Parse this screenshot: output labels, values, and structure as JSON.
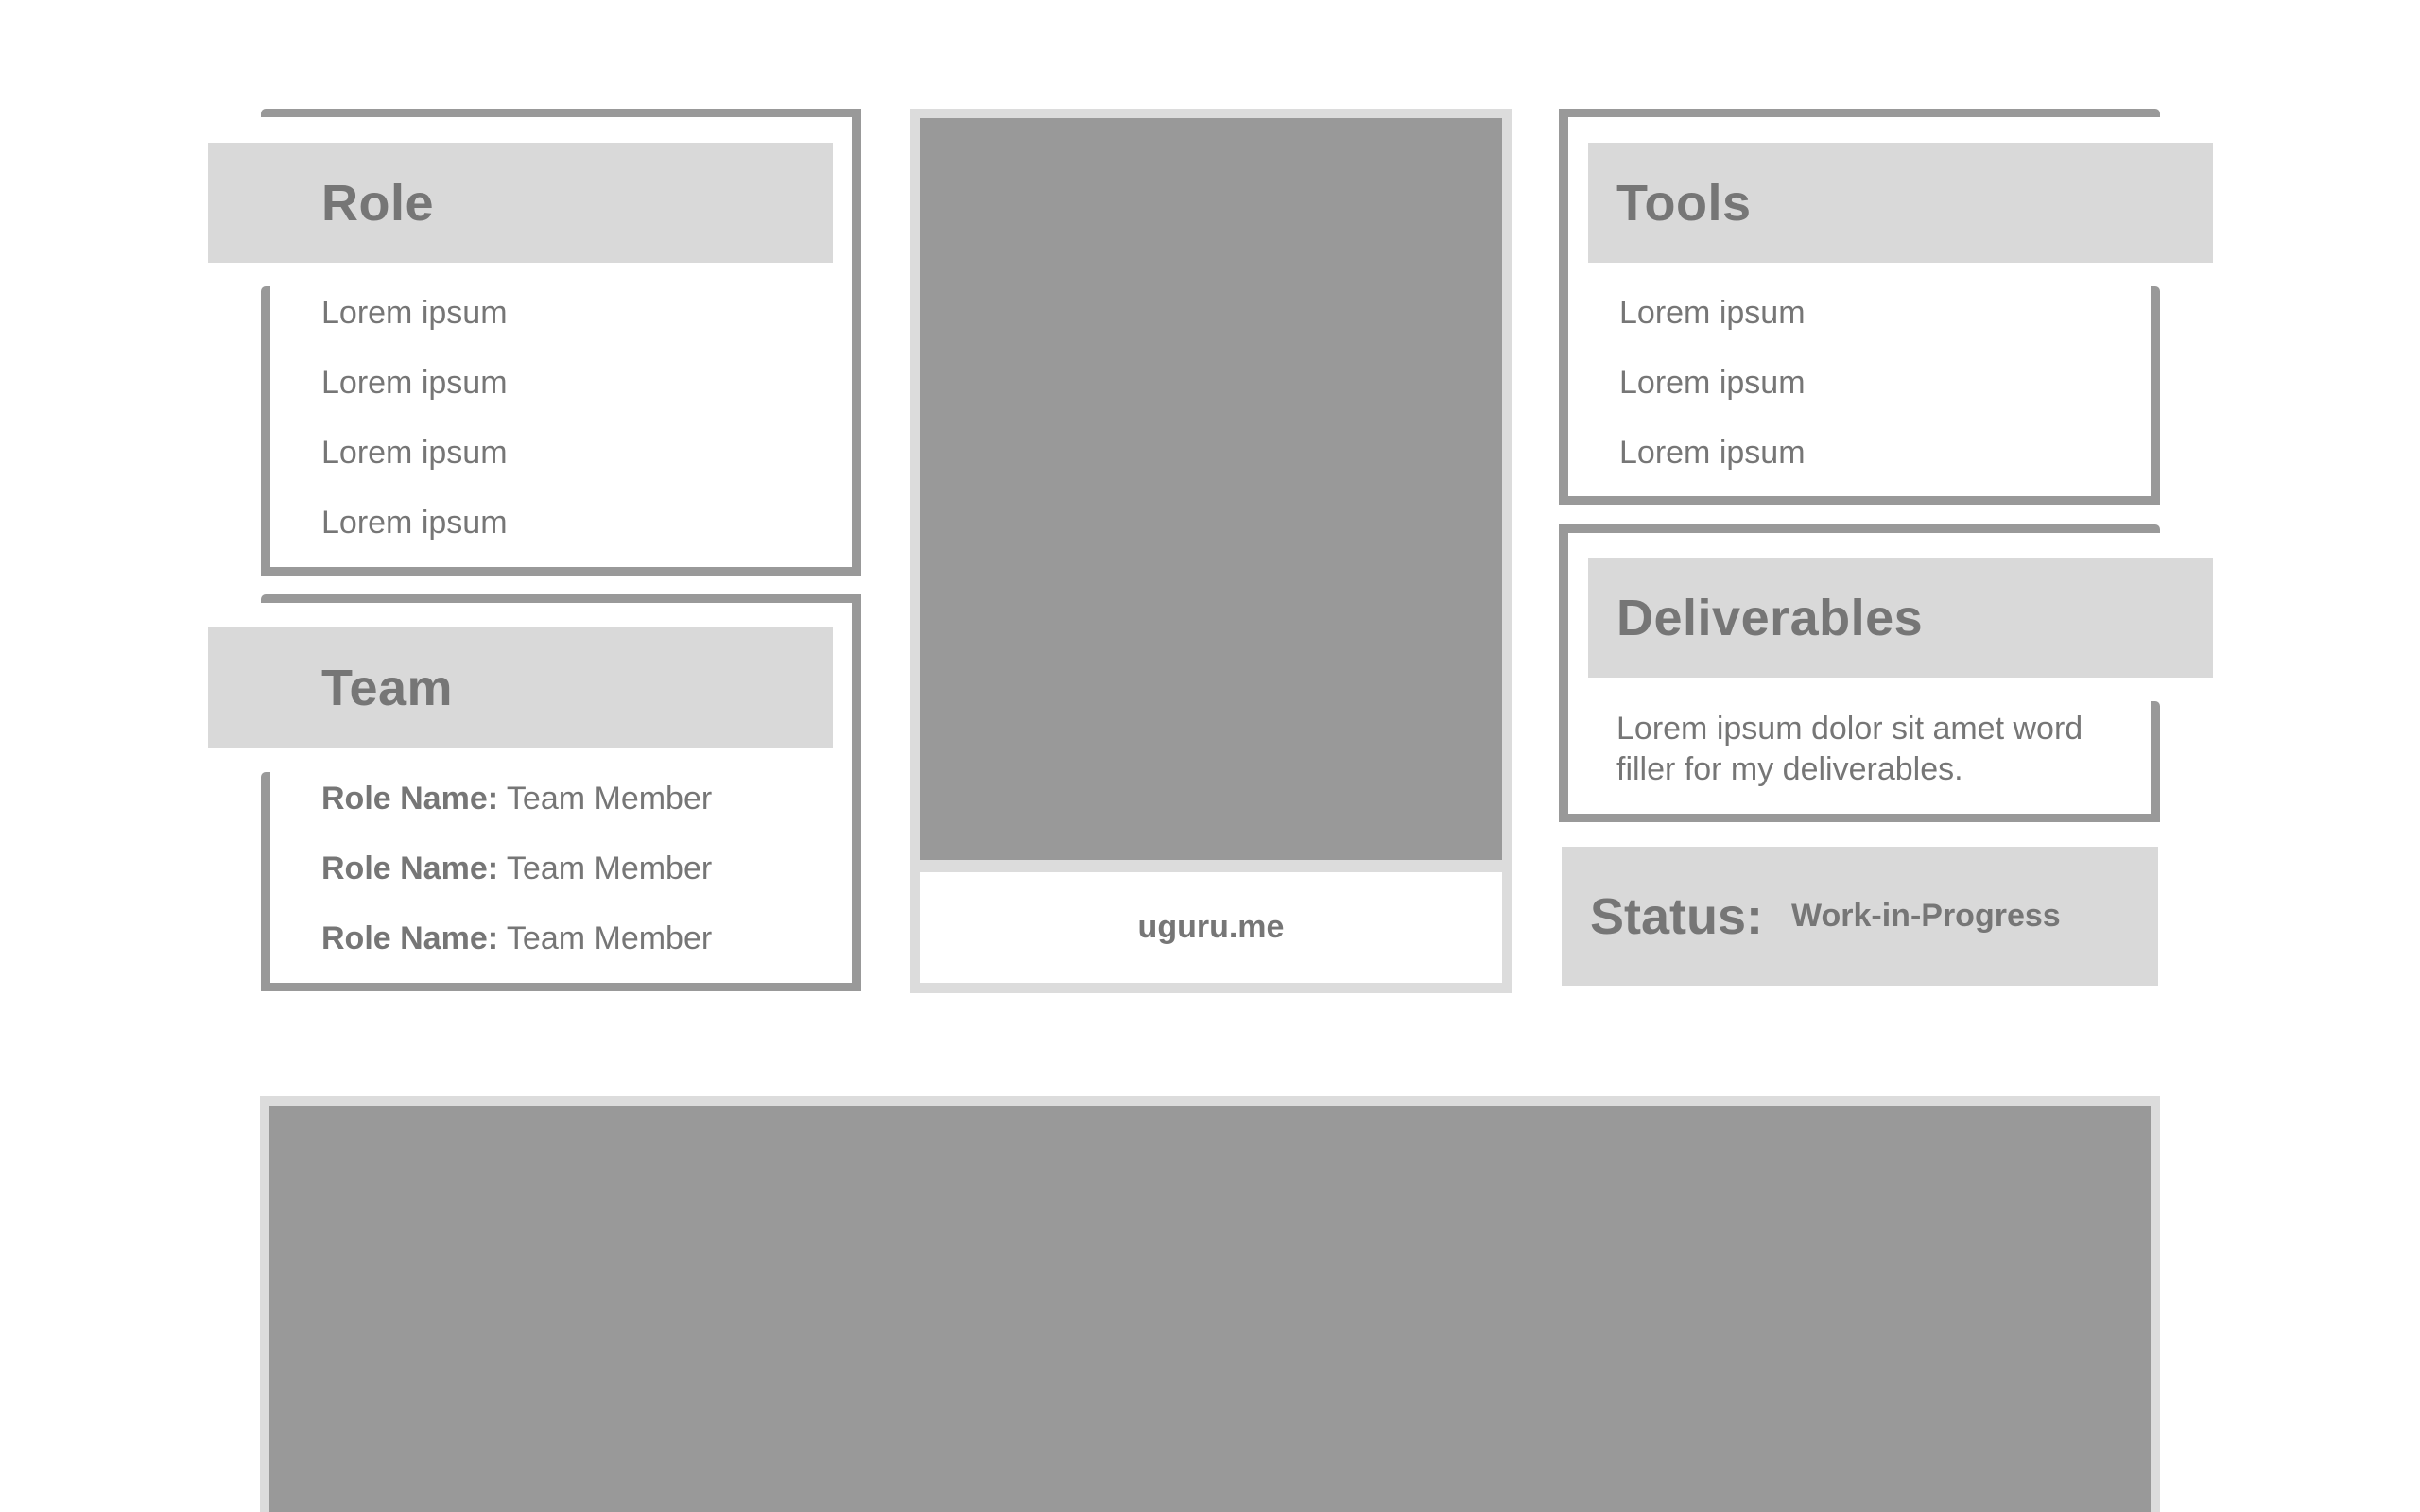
{
  "role": {
    "title": "Role",
    "items": [
      "Lorem ipsum",
      "Lorem ipsum",
      "Lorem ipsum",
      "Lorem ipsum"
    ]
  },
  "team": {
    "title": "Team",
    "members": [
      {
        "role_label": "Role Name:",
        "name": "Team Member"
      },
      {
        "role_label": "Role Name:",
        "name": "Team Member"
      },
      {
        "role_label": "Role Name:",
        "name": "Team Member"
      }
    ]
  },
  "project_card": {
    "caption": "uguru.me"
  },
  "tools": {
    "title": "Tools",
    "items": [
      "Lorem ipsum",
      "Lorem ipsum",
      "Lorem ipsum"
    ]
  },
  "deliverables": {
    "title": "Deliverables",
    "text_line1": "Lorem ipsum dolor sit amet word",
    "text_line2": "filler for my deliverables."
  },
  "status": {
    "label": "Status:",
    "value": "Work-in-Progress"
  },
  "colors": {
    "frame": "#999999",
    "header_bg": "#d9d9d9",
    "placeholder": "#999999",
    "card_border": "#dcdcdc",
    "text": "#767676"
  }
}
